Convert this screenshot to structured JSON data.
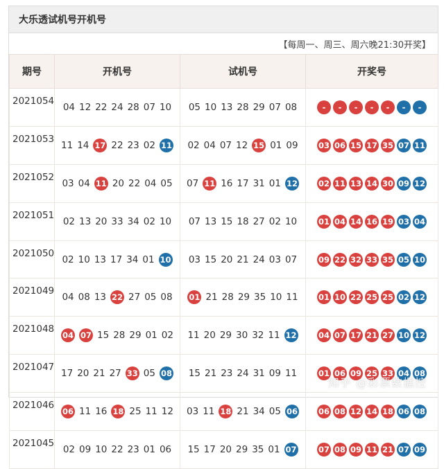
{
  "title": "大乐透试机号开机号",
  "schedule_note": "【每周一、周三、周六晚21:30开奖】",
  "headers": [
    "期号",
    "开机号",
    "试机号",
    "开奖号"
  ],
  "colors": {
    "red": "#d9413f",
    "blue": "#1f6fa8"
  },
  "rows": [
    {
      "period": "2021054",
      "open": [
        {
          "v": "04"
        },
        {
          "v": "12"
        },
        {
          "v": "22"
        },
        {
          "v": "24"
        },
        {
          "v": "28"
        },
        {
          "v": "07"
        },
        {
          "v": "10"
        }
      ],
      "test": [
        {
          "v": "05"
        },
        {
          "v": "10"
        },
        {
          "v": "13"
        },
        {
          "v": "28"
        },
        {
          "v": "29"
        },
        {
          "v": "07"
        },
        {
          "v": "08"
        }
      ],
      "draw": [
        "-",
        "-",
        "-",
        "-",
        "-",
        "-",
        "-"
      ]
    },
    {
      "period": "2021053",
      "open": [
        {
          "v": "11"
        },
        {
          "v": "14"
        },
        {
          "v": "17",
          "c": "red"
        },
        {
          "v": "22"
        },
        {
          "v": "23"
        },
        {
          "v": "02"
        },
        {
          "v": "11",
          "c": "blue"
        }
      ],
      "test": [
        {
          "v": "02"
        },
        {
          "v": "04"
        },
        {
          "v": "07"
        },
        {
          "v": "12"
        },
        {
          "v": "15",
          "c": "red"
        },
        {
          "v": "01"
        },
        {
          "v": "09"
        }
      ],
      "draw": [
        "03",
        "06",
        "15",
        "17",
        "35",
        "07",
        "11"
      ]
    },
    {
      "period": "2021052",
      "open": [
        {
          "v": "03"
        },
        {
          "v": "04"
        },
        {
          "v": "11",
          "c": "red"
        },
        {
          "v": "20"
        },
        {
          "v": "22"
        },
        {
          "v": "04"
        },
        {
          "v": "05"
        }
      ],
      "test": [
        {
          "v": "07"
        },
        {
          "v": "11",
          "c": "red"
        },
        {
          "v": "16"
        },
        {
          "v": "17"
        },
        {
          "v": "31"
        },
        {
          "v": "01"
        },
        {
          "v": "12",
          "c": "blue"
        }
      ],
      "draw": [
        "02",
        "11",
        "13",
        "14",
        "30",
        "09",
        "12"
      ]
    },
    {
      "period": "2021051",
      "open": [
        {
          "v": "02"
        },
        {
          "v": "13"
        },
        {
          "v": "20"
        },
        {
          "v": "33"
        },
        {
          "v": "34"
        },
        {
          "v": "02"
        },
        {
          "v": "10"
        }
      ],
      "test": [
        {
          "v": "07"
        },
        {
          "v": "13"
        },
        {
          "v": "15"
        },
        {
          "v": "18"
        },
        {
          "v": "27"
        },
        {
          "v": "02"
        },
        {
          "v": "10"
        }
      ],
      "draw": [
        "01",
        "04",
        "14",
        "16",
        "19",
        "03",
        "04"
      ]
    },
    {
      "period": "2021050",
      "open": [
        {
          "v": "02"
        },
        {
          "v": "10"
        },
        {
          "v": "13"
        },
        {
          "v": "17"
        },
        {
          "v": "34"
        },
        {
          "v": "01"
        },
        {
          "v": "10",
          "c": "blue"
        }
      ],
      "test": [
        {
          "v": "03"
        },
        {
          "v": "15"
        },
        {
          "v": "20"
        },
        {
          "v": "21"
        },
        {
          "v": "24"
        },
        {
          "v": "03"
        },
        {
          "v": "07"
        }
      ],
      "draw": [
        "09",
        "22",
        "32",
        "33",
        "35",
        "05",
        "10"
      ]
    },
    {
      "period": "2021049",
      "open": [
        {
          "v": "04"
        },
        {
          "v": "08"
        },
        {
          "v": "13"
        },
        {
          "v": "22",
          "c": "red"
        },
        {
          "v": "27"
        },
        {
          "v": "05"
        },
        {
          "v": "08"
        }
      ],
      "test": [
        {
          "v": "01",
          "c": "red"
        },
        {
          "v": "21"
        },
        {
          "v": "28"
        },
        {
          "v": "29"
        },
        {
          "v": "35"
        },
        {
          "v": "10"
        },
        {
          "v": "11"
        }
      ],
      "draw": [
        "01",
        "10",
        "22",
        "25",
        "25",
        "02",
        "12"
      ]
    },
    {
      "period": "2021048",
      "open": [
        {
          "v": "04",
          "c": "red"
        },
        {
          "v": "07",
          "c": "red"
        },
        {
          "v": "15"
        },
        {
          "v": "28"
        },
        {
          "v": "29"
        },
        {
          "v": "01"
        },
        {
          "v": "02"
        }
      ],
      "test": [
        {
          "v": "11"
        },
        {
          "v": "20"
        },
        {
          "v": "29"
        },
        {
          "v": "30"
        },
        {
          "v": "32"
        },
        {
          "v": "11"
        },
        {
          "v": "12",
          "c": "blue"
        }
      ],
      "draw": [
        "04",
        "07",
        "17",
        "21",
        "27",
        "10",
        "12"
      ]
    },
    {
      "period": "2021047",
      "open": [
        {
          "v": "17"
        },
        {
          "v": "20"
        },
        {
          "v": "21"
        },
        {
          "v": "27"
        },
        {
          "v": "33",
          "c": "red"
        },
        {
          "v": "05"
        },
        {
          "v": "08",
          "c": "blue"
        }
      ],
      "test": [
        {
          "v": "15"
        },
        {
          "v": "21"
        },
        {
          "v": "23"
        },
        {
          "v": "24"
        },
        {
          "v": "31"
        },
        {
          "v": "09"
        },
        {
          "v": "11"
        }
      ],
      "draw": [
        "01",
        "06",
        "09",
        "25",
        "33",
        "04",
        "08"
      ]
    },
    {
      "period": "2021046",
      "open": [
        {
          "v": "06",
          "c": "red"
        },
        {
          "v": "11"
        },
        {
          "v": "16"
        },
        {
          "v": "18",
          "c": "red"
        },
        {
          "v": "25"
        },
        {
          "v": "11"
        },
        {
          "v": "12"
        }
      ],
      "test": [
        {
          "v": "03"
        },
        {
          "v": "11"
        },
        {
          "v": "18",
          "c": "red"
        },
        {
          "v": "21"
        },
        {
          "v": "34"
        },
        {
          "v": "05"
        },
        {
          "v": "06",
          "c": "blue"
        }
      ],
      "draw": [
        "06",
        "08",
        "12",
        "14",
        "18",
        "06",
        "08"
      ]
    },
    {
      "period": "2021045",
      "open": [
        {
          "v": "02"
        },
        {
          "v": "09"
        },
        {
          "v": "10"
        },
        {
          "v": "22"
        },
        {
          "v": "23"
        },
        {
          "v": "01"
        },
        {
          "v": "06"
        }
      ],
      "test": [
        {
          "v": "15"
        },
        {
          "v": "17"
        },
        {
          "v": "20"
        },
        {
          "v": "29"
        },
        {
          "v": "35"
        },
        {
          "v": "01"
        },
        {
          "v": "07",
          "c": "blue"
        }
      ],
      "draw": [
        "07",
        "08",
        "09",
        "11",
        "21",
        "07",
        "09"
      ]
    }
  ],
  "watermark": "知乎 @彩票数据控"
}
